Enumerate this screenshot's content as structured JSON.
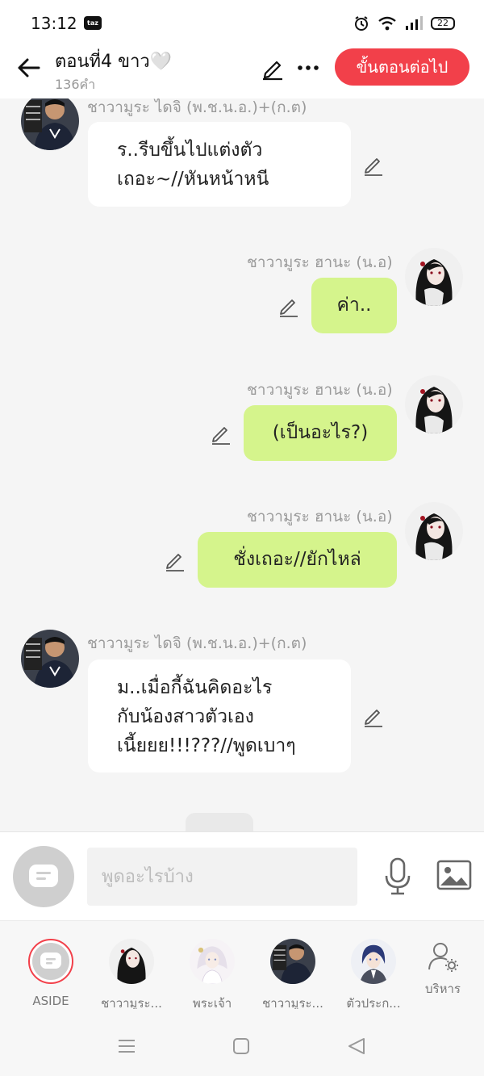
{
  "status": {
    "time": "13:12",
    "app_badge": "taz",
    "battery": "22"
  },
  "header": {
    "title": "ตอนที่4 ขาว🤍",
    "word_count": "136คำ",
    "next_label": "ขั้นตอนต่อไป"
  },
  "messages": [
    {
      "sender": "ชาวามูระ ไดจิ (พ.ช.น.อ.)+(ก.ต)",
      "side": "left",
      "lines": [
        "ร..รีบขึ้นไปแต่งตัว",
        "เถอะ~//หันหน้าหนี"
      ]
    },
    {
      "sender": "ชาวามูระ ฮานะ (น.อ)",
      "side": "right",
      "lines": [
        "ค่า.."
      ]
    },
    {
      "sender": "ชาวามูระ ฮานะ (น.อ)",
      "side": "right",
      "lines": [
        "(เป็นอะไร?)"
      ]
    },
    {
      "sender": "ชาวามูระ ฮานะ (น.อ)",
      "side": "right",
      "lines": [
        "ชั่งเถอะ//ยักไหล่"
      ]
    },
    {
      "sender": "ชาวามูระ ไดจิ (พ.ช.น.อ.)+(ก.ต)",
      "side": "left",
      "lines": [
        "ม..เมื่อกี้ฉันคิดอะไร",
        "กับน้องสาวตัวเอง",
        "เนี้ยยย!!!???//พูดเบาๆ"
      ]
    }
  ],
  "input": {
    "placeholder": "พูดอะไรบ้าง"
  },
  "characters": [
    {
      "label": "ASIDE"
    },
    {
      "label": "ชาวามูระ..."
    },
    {
      "label": "พระเจ้า"
    },
    {
      "label": "ชาวามูระ..."
    },
    {
      "label": "ตัวประก..."
    },
    {
      "label": "บริหาร"
    }
  ],
  "colors": {
    "accent": "#f2404a",
    "bubble_right": "#d5f48c",
    "bubble_left": "#ffffff",
    "background": "#f5f5f5"
  }
}
